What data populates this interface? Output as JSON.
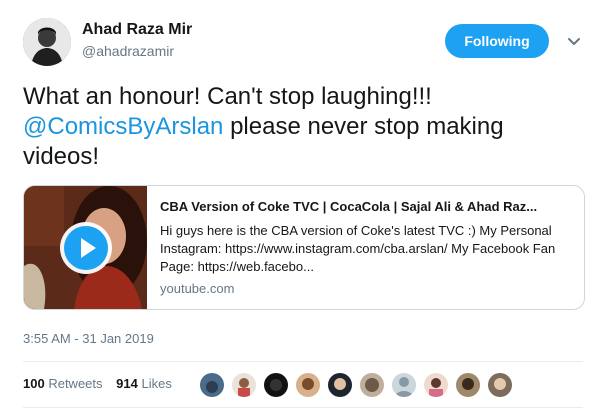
{
  "author": {
    "name": "Ahad Raza Mir",
    "handle": "@ahadrazamir"
  },
  "follow_button": {
    "label": "Following"
  },
  "tweet": {
    "text_before": "What an honour! Can't stop laughing!!! ",
    "mention": "@ComicsByArslan",
    "text_after": " please never stop making videos!"
  },
  "card": {
    "title": "CBA Version of Coke TVC | CocaCola | Sajal Ali & Ahad Raz...",
    "description": "Hi guys here is the CBA version of Coke's latest TVC :) My Personal Instagram: https://www.instagram.com/cba.arslan/ My Facebook Fan Page: https://web.facebo...",
    "domain": "youtube.com"
  },
  "timestamp": "3:55 AM - 31 Jan 2019",
  "stats": {
    "retweets_count": "100",
    "retweets_label": "Retweets",
    "likes_count": "914",
    "likes_label": "Likes"
  },
  "colors": {
    "accent": "#1da1f2",
    "mention": "#1b95e0",
    "secondary_text": "#657786"
  },
  "icons": {
    "play": "play-icon",
    "caret": "chevron-down-icon"
  }
}
